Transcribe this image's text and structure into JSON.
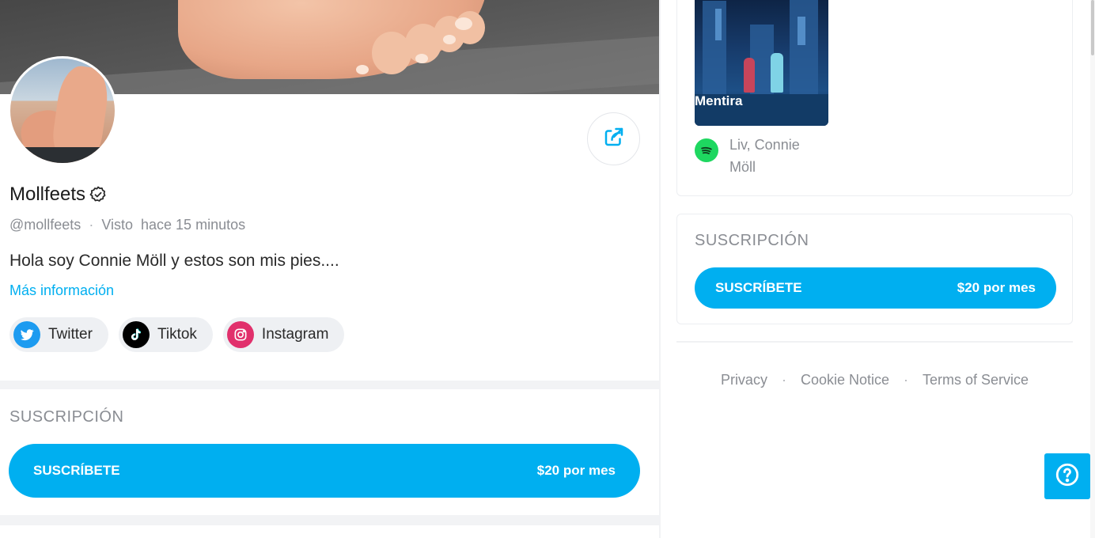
{
  "profile": {
    "name": "Mollfeets",
    "handle": "@mollfeets",
    "seen_label": "Visto",
    "seen_time": "hace 15 minutos",
    "bio": "Hola soy Connie Möll y estos son mis pies....",
    "more_link": "Más información"
  },
  "socials": [
    {
      "label": "Twitter",
      "icon": "twitter-icon",
      "color": "#1d9bf0"
    },
    {
      "label": "Tiktok",
      "icon": "tiktok-icon",
      "color": "#000000"
    },
    {
      "label": "Instagram",
      "icon": "instagram-icon",
      "color": "#e1306c"
    }
  ],
  "subscription_main": {
    "title": "SUSCRIPCIÓN",
    "button_label": "SUSCRÍBETE",
    "price": "$20 por mes"
  },
  "spotify": {
    "album_title": "Mentira",
    "artist_line1": "Liv, Connie",
    "artist_line2": "Möll"
  },
  "subscription_side": {
    "title": "SUSCRIPCIÓN",
    "button_label": "SUSCRÍBETE",
    "price": "$20 por mes"
  },
  "footer": {
    "privacy": "Privacy",
    "cookie": "Cookie Notice",
    "terms": "Terms of Service"
  },
  "colors": {
    "accent": "#00aff0",
    "muted_text": "#8a8d93",
    "spotify": "#1ed760"
  }
}
